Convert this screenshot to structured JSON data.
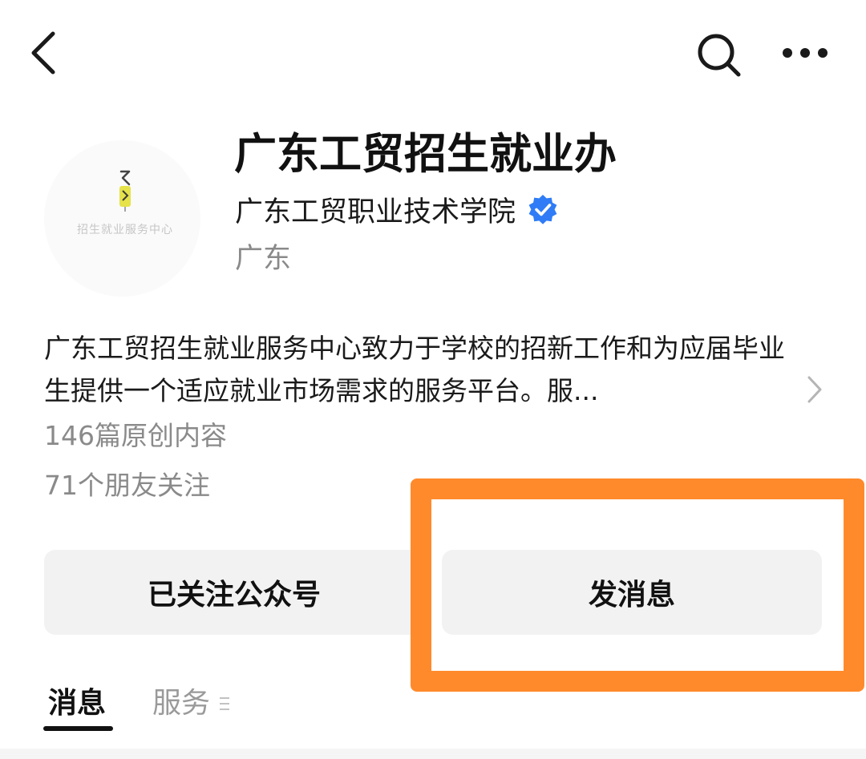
{
  "header": {
    "back_icon": "chevron-left-icon",
    "search_icon": "search-icon",
    "more_icon": "more-horizontal-icon"
  },
  "profile": {
    "avatar_caption": "招生就业服务中心",
    "account_name": "广东工贸招生就业办",
    "organization": "广东工贸职业技术学院",
    "verified_icon": "verified-badge-icon",
    "verified_color": "#2f7cf6",
    "region": "广东"
  },
  "description": {
    "text": "广东工贸招生就业服务中心致力于学校的招新工作和为应届毕业生提供一个适应就业市场需求的服务平台。服...",
    "expand_icon": "chevron-right-icon"
  },
  "stats": {
    "articles": "146篇原创内容",
    "friends_following": "71个朋友关注"
  },
  "actions": {
    "follow_label": "已关注公众号",
    "message_label": "发消息"
  },
  "tabs": [
    {
      "label": "消息",
      "active": true
    },
    {
      "label": "服务",
      "active": false,
      "icon": "menu-lines-icon"
    }
  ],
  "colors": {
    "highlight": "#ff8a2b",
    "button_bg": "#f2f2f2",
    "muted_text": "#8a8a8a"
  }
}
